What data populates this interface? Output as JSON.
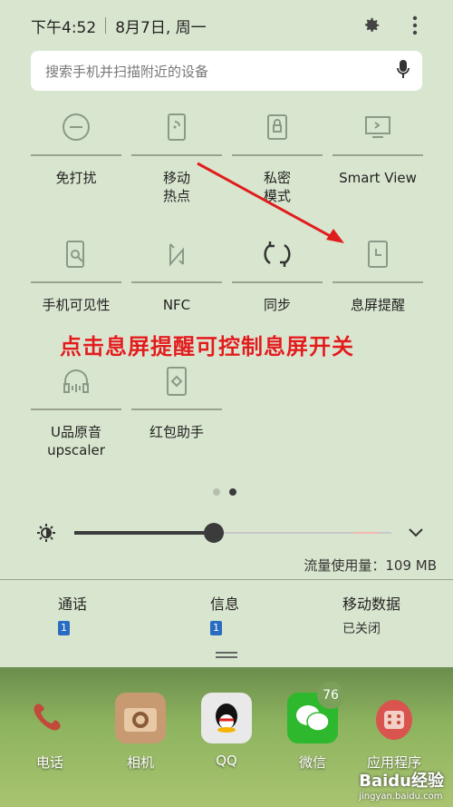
{
  "status_bar": {
    "time": "下午4:52",
    "date": "8月7日, 周一"
  },
  "search": {
    "placeholder": "搜索手机并扫描附近的设备"
  },
  "tiles_row1": [
    {
      "label": "免打扰",
      "icon": "do-not-disturb-icon"
    },
    {
      "label": "移动\n热点",
      "icon": "mobile-hotspot-icon"
    },
    {
      "label": "私密\n模式",
      "icon": "private-mode-icon"
    },
    {
      "label": "Smart View",
      "icon": "smart-view-icon"
    }
  ],
  "tiles_row2": [
    {
      "label": "手机可见性",
      "icon": "phone-visibility-icon"
    },
    {
      "label": "NFC",
      "icon": "nfc-icon"
    },
    {
      "label": "同步",
      "icon": "sync-icon"
    },
    {
      "label": "息屏提醒",
      "icon": "always-on-display-icon"
    }
  ],
  "tiles_row3": [
    {
      "label": "U品原音\nupscaler",
      "icon": "uhq-upscaler-icon"
    },
    {
      "label": "红包助手",
      "icon": "red-envelope-icon"
    }
  ],
  "annotation": "点击息屏提醒可控制息屏开关",
  "brightness": {
    "level": 0.44
  },
  "data_usage": "流量使用量：109 MB",
  "info": {
    "call": {
      "title": "通话",
      "sim": "1"
    },
    "message": {
      "title": "信息",
      "sim": "1"
    },
    "mobile_data": {
      "title": "移动数据",
      "value": "已关闭"
    }
  },
  "dock": [
    {
      "label": "电话"
    },
    {
      "label": "相机"
    },
    {
      "label": "QQ"
    },
    {
      "label": "微信",
      "badge": "76"
    },
    {
      "label": "应用程序"
    }
  ],
  "watermark": {
    "brand": "Baidu经验",
    "sub": "jingyan.baidu.com"
  },
  "colors": {
    "panel": "#d9e6cf",
    "annotation": "#e01d1d",
    "sim": "#2a6cc2"
  }
}
